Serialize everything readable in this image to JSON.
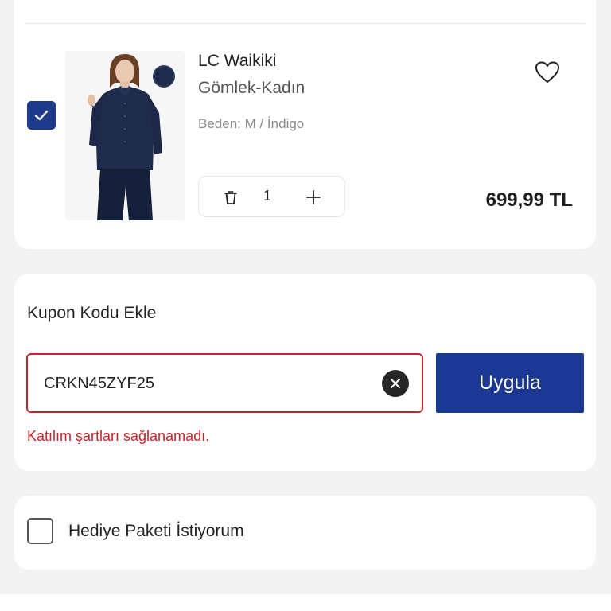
{
  "product": {
    "brand": "LC Waikiki",
    "name": "Gömlek-Kadın",
    "variant": "Beden: M /  İndigo",
    "quantity": "1",
    "price": "699,99 TL",
    "selected": true,
    "icons": {
      "favorite": "heart-outline-icon",
      "delete": "trash-icon",
      "increase": "plus-icon",
      "checkbox": "check-icon"
    }
  },
  "coupon": {
    "title": "Kupon Kodu Ekle",
    "code": "CRKN45ZYF25",
    "apply_label": "Uygula",
    "error": "Katılım şartları sağlanamadı.",
    "icons": {
      "clear": "close-icon"
    }
  },
  "gift": {
    "label": "Hediye Paketi İstiyorum",
    "checked": false
  },
  "colors": {
    "brand_blue": "#1a3894",
    "error_red": "#c8242b",
    "background": "#f3f3f3"
  }
}
